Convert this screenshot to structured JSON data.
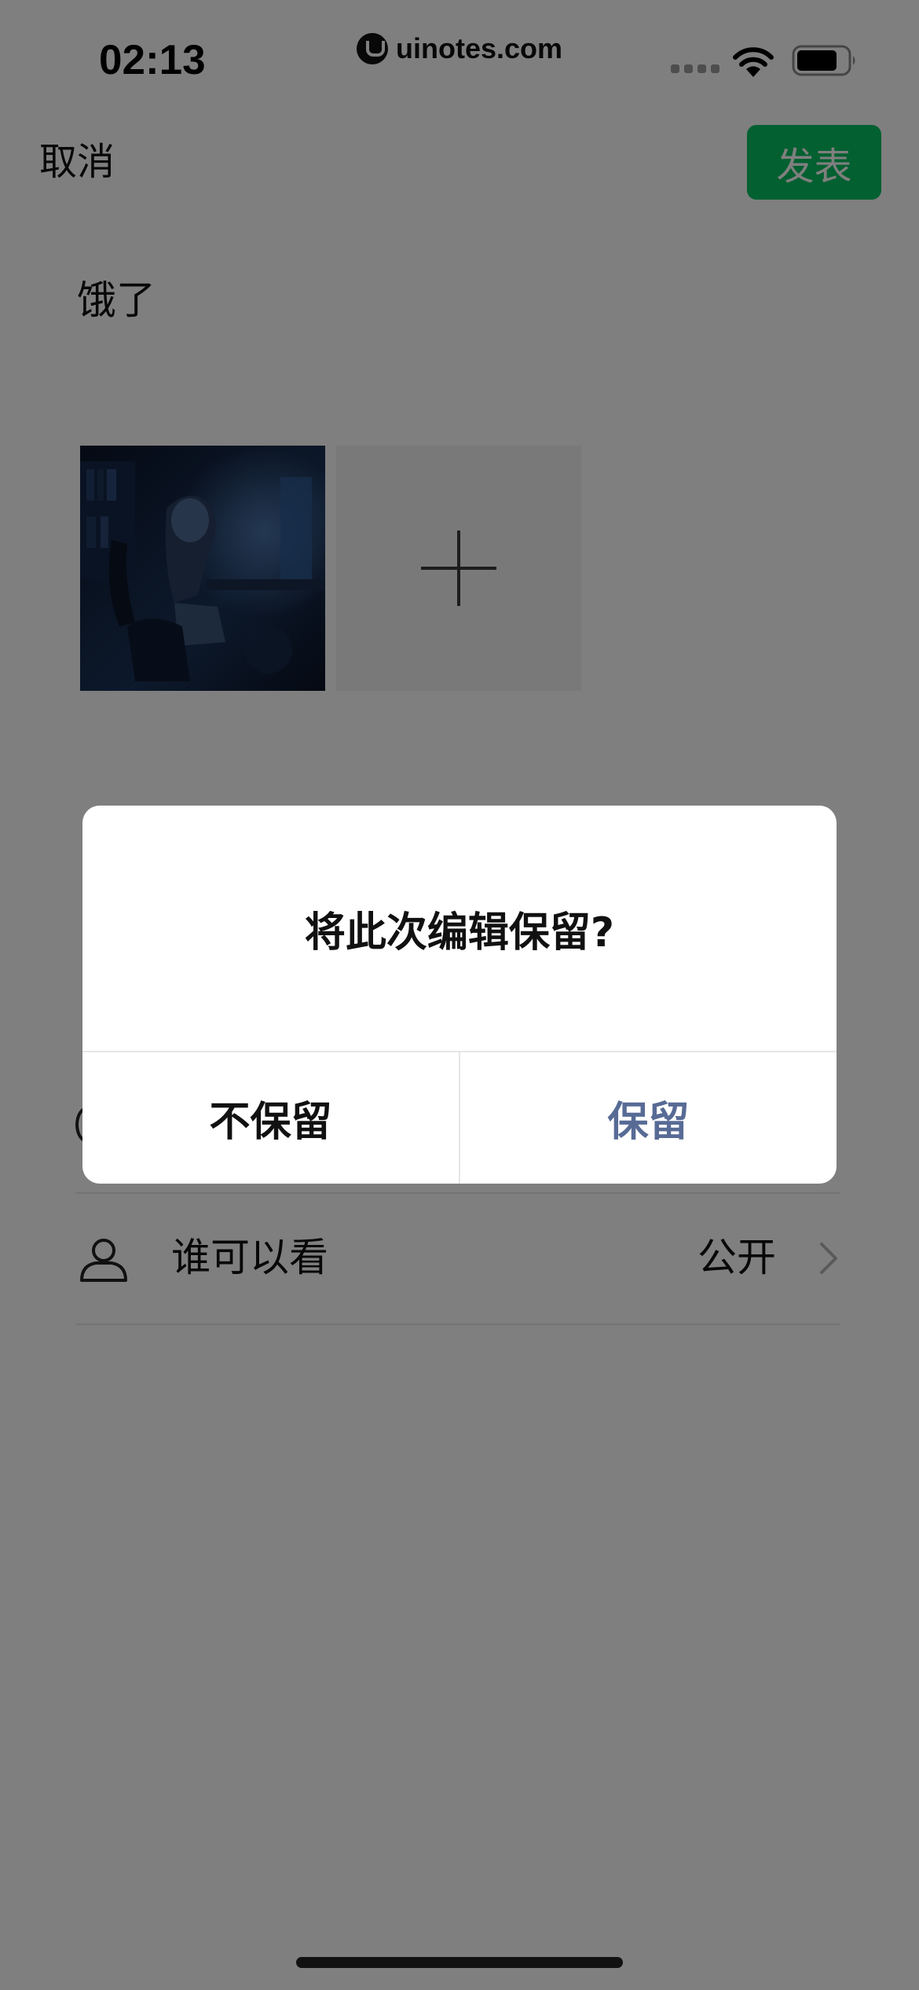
{
  "status_bar": {
    "time": "02:13",
    "url": "uinotes.com"
  },
  "header": {
    "cancel_label": "取消",
    "publish_label": "发表"
  },
  "post": {
    "text": "饿了",
    "photos": [
      {
        "icon": "anime-girl-at-desk-photo"
      }
    ]
  },
  "options": {
    "visibility_label": "谁可以看",
    "visibility_value": "公开"
  },
  "dialog": {
    "title": "将此次编辑保留?",
    "discard_label": "不保留",
    "keep_label": "保留"
  },
  "colors": {
    "publish_button": "#07c160",
    "dialog_accent": "#576b95",
    "overlay": "rgba(0,0,0,0.5)"
  }
}
